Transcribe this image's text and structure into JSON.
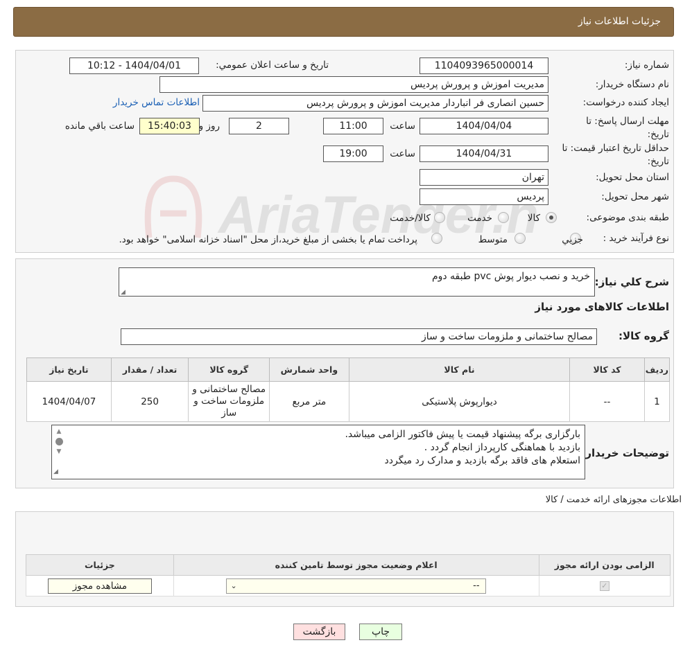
{
  "header": {
    "title": "جزئیات اطلاعات نیاز"
  },
  "info": {
    "need_number_label": "شماره نیاز:",
    "need_number": "1104093965000014",
    "announce_label": "تاريخ و ساعت اعلان عمومي:",
    "announce_value": "1404/04/01 - 10:12",
    "buyer_org_label": "نام دستگاه خريدار:",
    "buyer_org": "مديريت اموزش و پرورش پرديس",
    "requester_label": "ايجاد کننده درخواست:",
    "requester": "حسين انصاری فر انباردار مديريت اموزش و پرورش پرديس",
    "contact_link": "اطلاعات تماس خريدار",
    "reply_deadline_label": "مهلت ارسال پاسخ: تا تاريخ:",
    "reply_date": "1404/04/04",
    "time_label": "ساعت",
    "reply_time": "11:00",
    "days_value": "2",
    "days_label": "روز و",
    "remaining_time": "15:40:03",
    "remaining_label": "ساعت باقي مانده",
    "validity_label": "حداقل تاريخ اعتبار قيمت: تا تاريخ:",
    "validity_date": "1404/04/31",
    "validity_time": "19:00",
    "province_label": "استان محل تحويل:",
    "province": "تهران",
    "city_label": "شهر محل تحويل:",
    "city": "پرديس",
    "category_label": "طبقه بندی موضوعی:",
    "category_options": [
      "کالا",
      "خدمت",
      "کالا/خدمت"
    ],
    "process_label": "نوع فرآيند خريد :",
    "process_options": [
      "جزيي",
      "متوسط"
    ],
    "process_note": "پرداخت تمام يا بخشی از مبلغ خريد،از محل \"اسناد خزانه اسلامی\" خواهد بود."
  },
  "details": {
    "desc_label": "شرح كلي نياز:",
    "desc_value": "خريد و نصب ديوار پوش pvc طبقه دوم",
    "goods_info_title": "اطلاعات کالاهای مورد نياز",
    "goods_group_label": "گروه کالا:",
    "goods_group_value": "مصالح ساختمانی و ملزومات ساخت و ساز",
    "table_headers": [
      "رديف",
      "کد کالا",
      "نام کالا",
      "واحد شمارش",
      "گروه کالا",
      "تعداد / مقدار",
      "تاريخ نياز"
    ],
    "rows": [
      [
        "1",
        "--",
        "ديوارپوش پلاستيکی",
        "متر مربع",
        "مصالح ساختمانی و ملزومات ساخت و ساز",
        "250",
        "1404/04/07"
      ]
    ],
    "buyer_notes_label": "توضيحات خريدار:",
    "buyer_notes": [
      "بارگزاری برگه پيشنهاد قيمت يا پيش فاکتور الزامی ميباشد.",
      "بازديد با هماهنگی کارپرداز انجام گردد .",
      " استعلام های فاقد برگه بازديد و مدارک رد ميگردد"
    ]
  },
  "licenses": {
    "title": "اطلاعات مجوزهای ارائه خدمت / کالا",
    "headers": [
      "الزامی بودن ارائه مجوز",
      "اعلام وضعيت مجوز توسط تامين کننده",
      "جزئيات"
    ],
    "select_value": "--",
    "view_button": "مشاهده مجوز"
  },
  "footer": {
    "print_button": "چاپ",
    "back_button": "بازگشت"
  },
  "watermark": {
    "text": "AriaTender.neT"
  },
  "colors": {
    "header_bg": "#8b6c44",
    "link": "#1a5fb4",
    "back_button_bg": "#ffe0e0",
    "print_button_bg": "#e8ffe0",
    "highlight": "#ffffcc"
  }
}
